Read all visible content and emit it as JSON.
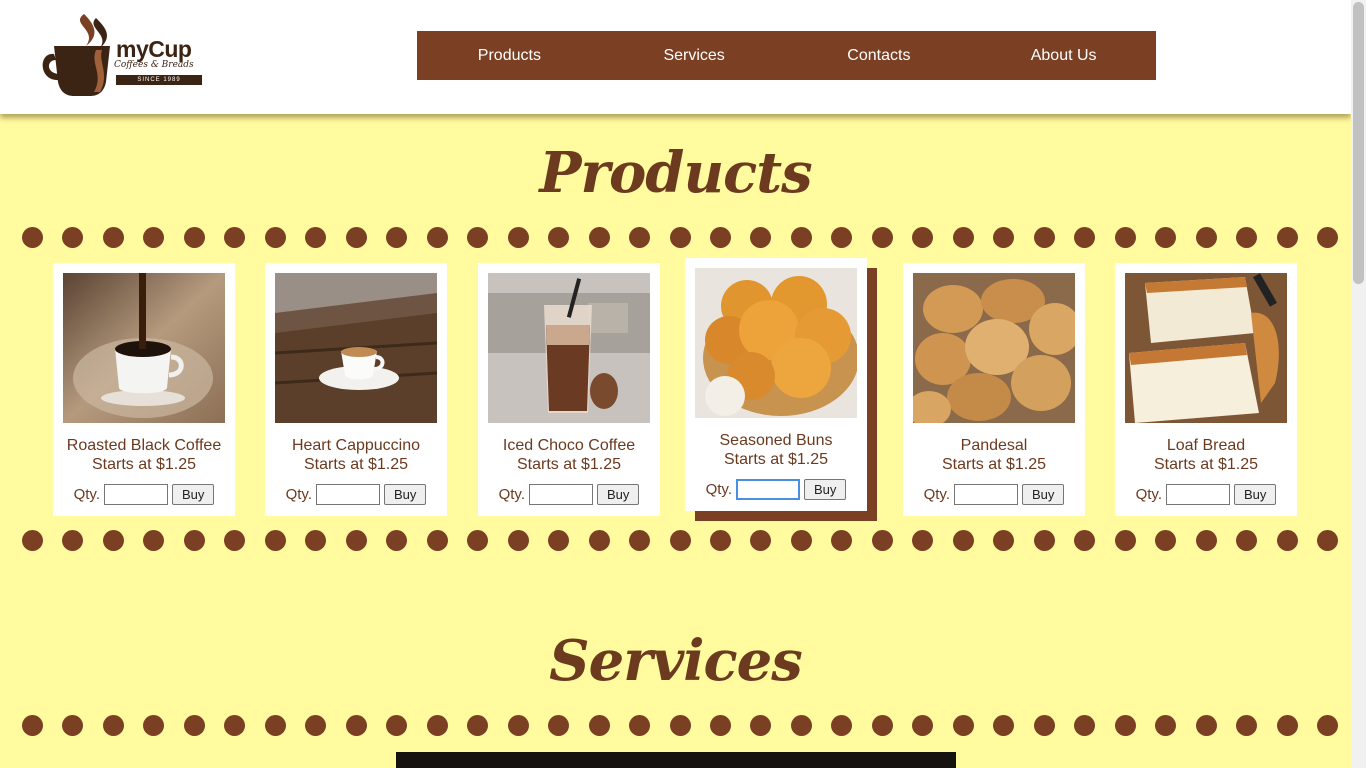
{
  "brand": {
    "name": "myCup",
    "tagline": "Coffees & Breads",
    "since": "SINCE 1989"
  },
  "nav": {
    "items": [
      {
        "label": "Products"
      },
      {
        "label": "Services"
      },
      {
        "label": "Contacts"
      },
      {
        "label": "About Us"
      }
    ]
  },
  "sections": {
    "products_title": "Products",
    "services_title": "Services"
  },
  "products": [
    {
      "name": "Roasted Black Coffee",
      "price": "Starts at $1.25",
      "qty_label": "Qty.",
      "buy_label": "Buy",
      "image": "black-coffee-photo"
    },
    {
      "name": "Heart Cappuccino",
      "price": "Starts at $1.25",
      "qty_label": "Qty.",
      "buy_label": "Buy",
      "image": "cappuccino-photo"
    },
    {
      "name": "Iced Choco Coffee",
      "price": "Starts at $1.25",
      "qty_label": "Qty.",
      "buy_label": "Buy",
      "image": "iced-choco-photo"
    },
    {
      "name": "Seasoned Buns",
      "price": "Starts at $1.25",
      "qty_label": "Qty.",
      "buy_label": "Buy",
      "image": "buns-photo"
    },
    {
      "name": "Pandesal",
      "price": "Starts at $1.25",
      "qty_label": "Qty.",
      "buy_label": "Buy",
      "image": "pandesal-photo"
    },
    {
      "name": "Loaf Bread",
      "price": "Starts at $1.25",
      "qty_label": "Qty.",
      "buy_label": "Buy",
      "image": "loaf-bread-photo"
    }
  ],
  "colors": {
    "background": "#fffb9e",
    "brand_brown": "#7b4023",
    "text_brown": "#6b3a1f",
    "header": "#ffffff"
  }
}
